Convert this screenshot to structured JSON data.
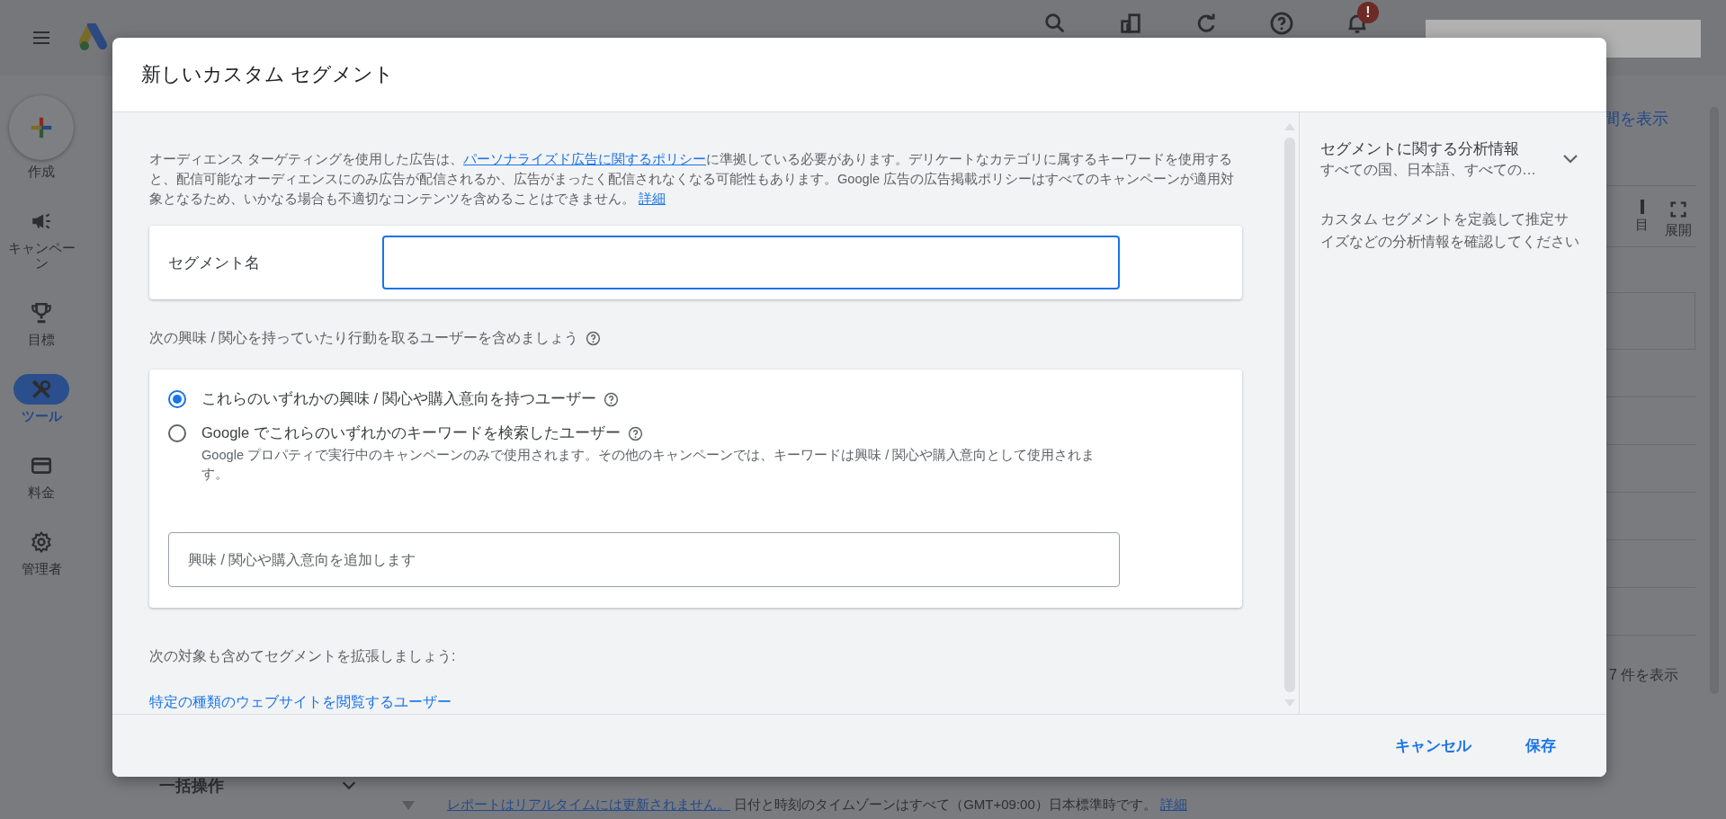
{
  "background": {
    "header": {
      "notification_badge": "!"
    },
    "nav": [
      {
        "kind": "fab",
        "label": "作成",
        "selected": false
      },
      {
        "kind": "campaign",
        "label": "キャンペーン",
        "selected": false
      },
      {
        "kind": "goal",
        "label": "目標",
        "selected": false
      },
      {
        "kind": "tools",
        "label": "ツール",
        "selected": true
      },
      {
        "kind": "billing",
        "label": "料金",
        "selected": false
      },
      {
        "kind": "admin",
        "label": "管理者",
        "selected": false
      }
    ],
    "period_link": "間を表示",
    "toolbar": [
      {
        "kind": "columns",
        "label": "目"
      },
      {
        "kind": "expand",
        "label": "展開"
      }
    ],
    "row_count": "7 件を表示",
    "bulk_actions": "一括操作",
    "footer_note": {
      "link": "レポートはリアルタイムには更新されません。",
      "text": "日付と時刻のタイムゾーンはすべて（GMT+09:00）日本標準時です。",
      "detail_link": "詳細"
    }
  },
  "dialog": {
    "title": "新しいカスタム セグメント",
    "policy": {
      "before": "オーディエンス ターゲティングを使用した広告は、",
      "link": "パーソナライズド広告に関するポリシー",
      "after": "に準拠している必要があります。デリケートなカテゴリに属するキーワードを使用すると、配信可能なオーディエンスにのみ広告が配信されるか、広告がまったく配信されなくなる可能性もあります。Google 広告の広告掲載ポリシーはすべてのキャンペーンが適用対象となるため、いかなる場合も不適切なコンテンツを含めることはできません。",
      "detail_link": "詳細"
    },
    "segment_name": {
      "label": "セグメント名",
      "focused": true
    },
    "include_heading": "次の興味 / 関心を持っていたり行動を取るユーザーを含めましょう",
    "options": [
      {
        "label": "これらのいずれかの興味 / 関心や購入意向を持つユーザー",
        "selected": true
      },
      {
        "label": "Google でこれらのいずれかのキーワードを検索したユーザー",
        "note": "Google プロパティで実行中のキャンペーンのみで使用されます。その他のキャンペーンでは、キーワードは興味 / 関心や購入意向として使用されます。",
        "selected": false
      }
    ],
    "interest_field": {
      "placeholder": "興味 / 関心や購入意向を追加します"
    },
    "expand_heading": "次の対象も含めてセグメントを拡張しましょう:",
    "expand_link": "特定の種類のウェブサイトを閲覧するユーザー",
    "insights": {
      "title": "セグメントに関する分析情報",
      "subtitle": "すべての国、日本語、すべての…",
      "expanded": false,
      "description": "カスタム セグメントを定義して推定サイズなどの分析情報を確認してください"
    },
    "buttons": [
      {
        "label": "キャンセル"
      },
      {
        "label": "保存"
      }
    ]
  }
}
